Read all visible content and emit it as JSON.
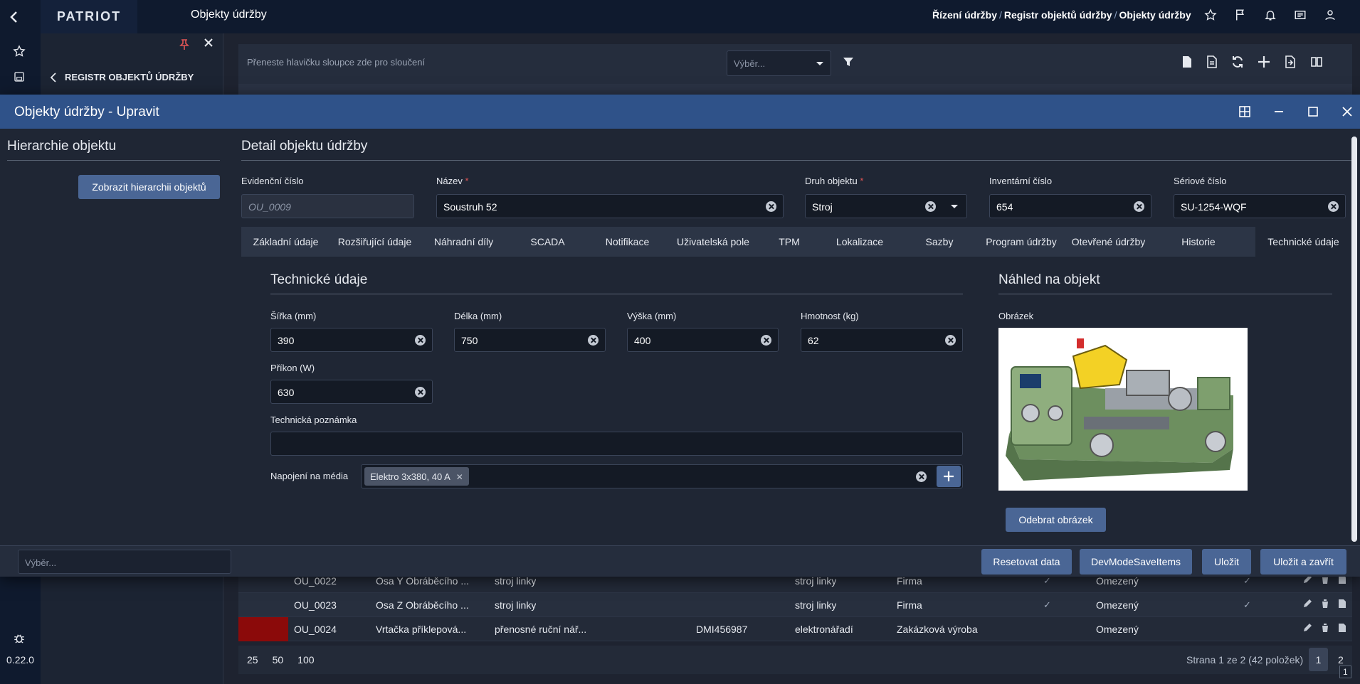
{
  "topbar": {
    "brand": "PATRIOT",
    "page_title": "Objekty údržby",
    "breadcrumb": [
      "Řízení údržby",
      "Registr objektů údržby",
      "Objekty údržby"
    ],
    "breadcrumb_sep": "/"
  },
  "rail": {
    "version": "0.22.0"
  },
  "drawer": {
    "back_label": "REGISTR OBJEKTŮ ÚDRŽBY"
  },
  "grid": {
    "group_hint": "Přeneste hlavičku sloupce zde pro sloučení",
    "select_placeholder": "Výběr...",
    "rows": [
      {
        "id": "OU_0022",
        "name": "Osa Y Obráběcího ...",
        "kind": "stroj linky",
        "c4": "",
        "c5": "",
        "class": "stroj linky",
        "owner": "Firma",
        "checked1": true,
        "access": "Omezený",
        "checked2": true,
        "flag": ""
      },
      {
        "id": "OU_0023",
        "name": "Osa Z Obráběcího ...",
        "kind": "stroj linky",
        "c4": "",
        "c5": "",
        "class": "stroj linky",
        "owner": "Firma",
        "checked1": true,
        "access": "Omezený",
        "checked2": true,
        "flag": ""
      },
      {
        "id": "OU_0024",
        "name": "Vrtačka příklepová...",
        "kind": "přenosné ruční nář...",
        "c4": "",
        "c5": "DMI456987",
        "class": "elektronářadí",
        "owner": "Zakázková výroba",
        "checked1": false,
        "access": "Omezený",
        "checked2": false,
        "flag": "#8b0a0a"
      }
    ],
    "page_sizes": [
      "25",
      "50",
      "100"
    ],
    "page_info": "Strana 1 ze 2 (42 položek)",
    "current_page": "1",
    "next_page": "2",
    "page_badge": "1"
  },
  "modal": {
    "title": "Objekty údržby - Upravit",
    "hierarchy": {
      "title": "Hierarchie objektu",
      "button": "Zobrazit hierarchii objektů"
    },
    "detail": {
      "title": "Detail objektu údržby",
      "fields": {
        "evidencni_label": "Evidenční číslo",
        "evidencni_value": "OU_0009",
        "nazev_label": "Název",
        "nazev_value": "Soustruh 52",
        "druh_label": "Druh objektu",
        "druh_value": "Stroj",
        "inventarni_label": "Inventární číslo",
        "inventarni_value": "654",
        "seriove_label": "Sériové číslo",
        "seriove_value": "SU-1254-WQF",
        "required_mark": "*"
      },
      "tabs": [
        "Základní údaje",
        "Rozšiřující údaje",
        "Náhradní díly",
        "SCADA",
        "Notifikace",
        "Uživatelská pole",
        "TPM",
        "Lokalizace",
        "Sazby",
        "Program údržby",
        "Otevřené údržby",
        "Historie",
        "Technické údaje"
      ],
      "active_tab": "Technické údaje"
    },
    "technical": {
      "title": "Technické údaje",
      "sirka_label": "Šířka (mm)",
      "sirka_value": "390",
      "delka_label": "Délka (mm)",
      "delka_value": "750",
      "vyska_label": "Výška (mm)",
      "vyska_value": "400",
      "hmotnost_label": "Hmotnost (kg)",
      "hmotnost_value": "62",
      "prikon_label": "Příkon (W)",
      "prikon_value": "630",
      "poznamka_label": "Technická poznámka",
      "poznamka_value": "",
      "media_label": "Napojení na média",
      "media_chips": [
        "Elektro 3x380, 40 A"
      ]
    },
    "preview": {
      "title": "Náhled na objekt",
      "image_label": "Obrázek",
      "remove_button": "Odebrat obrázek"
    },
    "footer": {
      "select_placeholder": "Výběr...",
      "reset": "Resetovat data",
      "devmode": "DevModeSaveItems",
      "save": "Uložit",
      "save_close": "Uložit a zavřít"
    }
  },
  "colors": {
    "header": "#2f5289",
    "topbar": "#0f1a2e",
    "button": "#4a6695",
    "required": "#e05555"
  }
}
